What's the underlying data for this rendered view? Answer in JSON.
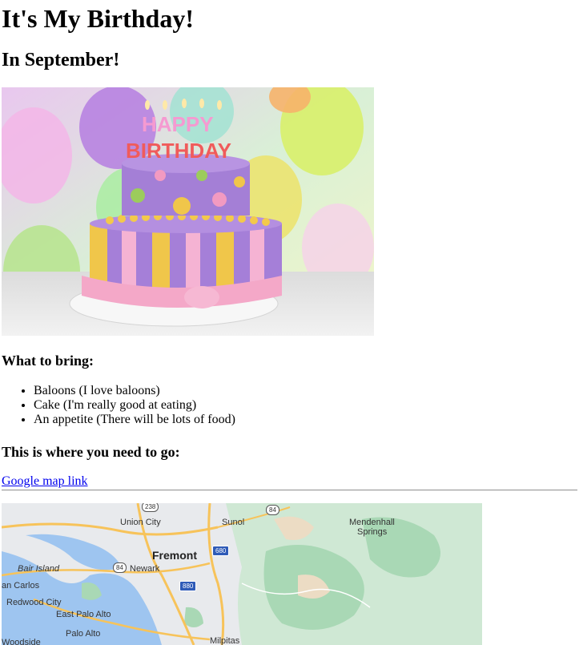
{
  "title": "It's My Birthday!",
  "subtitle": "In September!",
  "cake_image": {
    "cake_letters_top": "HAPPY",
    "cake_letters_bottom": "BIRTHDAY"
  },
  "bring": {
    "heading": "What to bring:",
    "items": [
      "Baloons (I love baloons)",
      "Cake (I'm really good at eating)",
      "An appetite (There will be lots of food)"
    ]
  },
  "location": {
    "heading": "This is where you need to go:",
    "link_text": "Google map link"
  },
  "map": {
    "labels": {
      "union_city": "Union City",
      "sunol": "Sunol",
      "mendenhall": "Mendenhall",
      "springs": "Springs",
      "fremont": "Fremont",
      "newark": "Newark",
      "bair_island": "Bair Island",
      "san_carlos": "an Carlos",
      "redwood_city": "Redwood City",
      "east_palo_alto": "East Palo Alto",
      "palo_alto": "Palo Alto",
      "woodside": "Woodside",
      "milpitas": "Milpitas"
    },
    "shields": {
      "r238": "238",
      "r84a": "84",
      "r84b": "84",
      "i680": "680",
      "i880": "880"
    }
  }
}
